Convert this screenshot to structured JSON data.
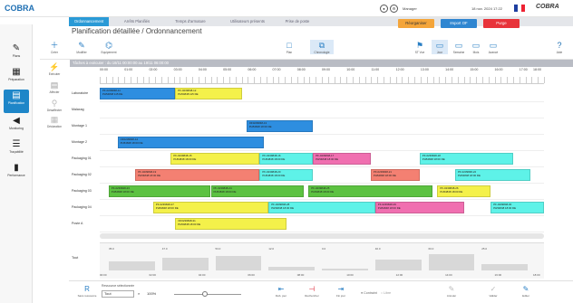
{
  "app": {
    "logo": "COBRA",
    "brand": "COBRA",
    "user": "Manager",
    "datetime": "18 nov. 2024 17:22"
  },
  "tabs": [
    "Ordonnancement",
    "Arrêts Planifiés",
    "Temps d'armature",
    "Utilisateurs présents",
    "Prise de poste"
  ],
  "sidebar": [
    "Plans",
    "Préparation",
    "Planification",
    "Monitoring",
    "Traçabilité",
    "Performance"
  ],
  "page_title": "Planification détaillée / Ordonnancement",
  "toolbar": {
    "left": [
      "Créer",
      "Modifier",
      "Equipement"
    ],
    "side": [
      "Exécuter",
      "Affecter",
      "Désaffecter",
      "Déclaration"
    ],
    "mid": [
      "Plan",
      "Chronologie"
    ],
    "views": [
      "ST Vue",
      "Jour",
      "Semaine",
      "Mois",
      "Avancé",
      "Aide"
    ],
    "buttons": [
      {
        "label": "Réorganiser",
        "color": "#f4a53a"
      },
      {
        "label": "Import OF",
        "color": "#2f86d1"
      },
      {
        "label": "Purge",
        "color": "#e8333a"
      }
    ]
  },
  "range_text": "Tâches à exécuter : du 18/11 00:00:00 au 19/11 06:00:00",
  "times": [
    "00:00",
    "01:00",
    "02:00",
    "03:00",
    "04:00",
    "05:00",
    "06:00",
    "07:00",
    "08:00",
    "09:00",
    "10:00",
    "11:00",
    "12:00",
    "13:00",
    "14:00",
    "15:00",
    "16:00",
    "17:00",
    "18:00"
  ],
  "rows": [
    "Laboratoire",
    "Malaxag",
    "Montage 1",
    "Montage 2",
    "Packaging 01",
    "Packaging 02",
    "Packaging 03",
    "Packaging 04",
    "Poste A"
  ],
  "tasks": [
    {
      "row": 0,
      "start": 0.0,
      "end": 0.17,
      "color": "#2e8ee0",
      "t1": "PF-0239848-11",
      "t2": "PH54848 115 DE"
    },
    {
      "row": 0,
      "start": 0.17,
      "end": 0.32,
      "color": "#f4f14a",
      "t1": "PF-0239848-12",
      "t2": "PH54848 115 DE"
    },
    {
      "row": 2,
      "start": 0.33,
      "end": 0.48,
      "color": "#2e8ee0",
      "t1": "OF0239848-13",
      "t2": "PH54848 18:00 DE"
    },
    {
      "row": 3,
      "start": 0.04,
      "end": 0.37,
      "color": "#2e8ee0",
      "t1": "OF0239848-14",
      "t2": "PH54848 18:00 DE"
    },
    {
      "row": 4,
      "start": 0.16,
      "end": 0.36,
      "color": "#f4f14a",
      "t1": "PF-0239848-15",
      "t2": "PH54848 18:00 DE"
    },
    {
      "row": 4,
      "start": 0.36,
      "end": 0.48,
      "color": "#5ef2e8",
      "t1": "PF-0239848-16",
      "t2": "PH54848 18:00 DE"
    },
    {
      "row": 4,
      "start": 0.48,
      "end": 0.61,
      "color": "#f06fb0",
      "t1": "PF-0239848-17",
      "t2": "PH54848 18:00 DE"
    },
    {
      "row": 4,
      "start": 0.72,
      "end": 0.93,
      "color": "#5ef2e8",
      "t1": "PF-0239848-18",
      "t2": "PH54848 18:00 DE"
    },
    {
      "row": 5,
      "start": 0.08,
      "end": 0.36,
      "color": "#f48072",
      "t1": "PF-0239848-19",
      "t2": "PH54848 18:00 DE"
    },
    {
      "row": 5,
      "start": 0.36,
      "end": 0.48,
      "color": "#5ef2e8",
      "t1": "PF-0239848-20",
      "t2": "PH54848 18:00 DE"
    },
    {
      "row": 5,
      "start": 0.61,
      "end": 0.72,
      "color": "#f48072",
      "t1": "PF-0239848-21",
      "t2": "PH54848 18:00 DE"
    },
    {
      "row": 5,
      "start": 0.8,
      "end": 0.97,
      "color": "#5ef2e8",
      "t1": "PF-0239848-22",
      "t2": "PH54848 18:00 DE"
    },
    {
      "row": 6,
      "start": 0.02,
      "end": 0.25,
      "color": "#5cc241",
      "t1": "PF-0239848-23",
      "t2": "PH54848 18:00 DE"
    },
    {
      "row": 6,
      "start": 0.25,
      "end": 0.46,
      "color": "#5cc241",
      "t1": "PF-0239848-24",
      "t2": "PH54848 18:00 DE"
    },
    {
      "row": 6,
      "start": 0.47,
      "end": 0.75,
      "color": "#5cc241",
      "t1": "PF-0239848-25",
      "t2": "PH54848 18:00 DE"
    },
    {
      "row": 6,
      "start": 0.76,
      "end": 0.88,
      "color": "#f4f14a",
      "t1": "PF-0239848-26",
      "t2": "PH54848 18:00 DE"
    },
    {
      "row": 7,
      "start": 0.12,
      "end": 0.38,
      "color": "#f4f14a",
      "t1": "PF-0239848-27",
      "t2": "PH54848 18:00 DE"
    },
    {
      "row": 7,
      "start": 0.38,
      "end": 0.62,
      "color": "#5ef2e8",
      "t1": "PF-0239848-28",
      "t2": "PH54848 18:00 DE"
    },
    {
      "row": 7,
      "start": 0.62,
      "end": 0.82,
      "color": "#f06fb0",
      "t1": "PF-0239848-29",
      "t2": "PH54848 18:00 DE"
    },
    {
      "row": 7,
      "start": 0.88,
      "end": 1.0,
      "color": "#5ef2e8",
      "t1": "PF-0239848-30",
      "t2": "PH54848 18:00 DE"
    },
    {
      "row": 8,
      "start": 0.17,
      "end": 0.42,
      "color": "#f4f14a",
      "t1": "OF0239848-31",
      "t2": "PH54848 18:00 DE"
    }
  ],
  "load_label": "Tout",
  "load_values": [
    "35.0",
    "47.0",
    "53.0",
    "12.0",
    "0.0",
    "40.0",
    "60.0",
    "25.0"
  ],
  "bottom": {
    "ressource_label": "Ressource sélectionnée",
    "ressource_value": "Tout",
    "zoom": "100%",
    "buttons": [
      "Sans ressource",
      "Rechercher",
      "Déb. jour",
      "Fin jour",
      "Contraint",
      "Libre",
      "Annuler",
      "Valider",
      "Editer"
    ]
  }
}
